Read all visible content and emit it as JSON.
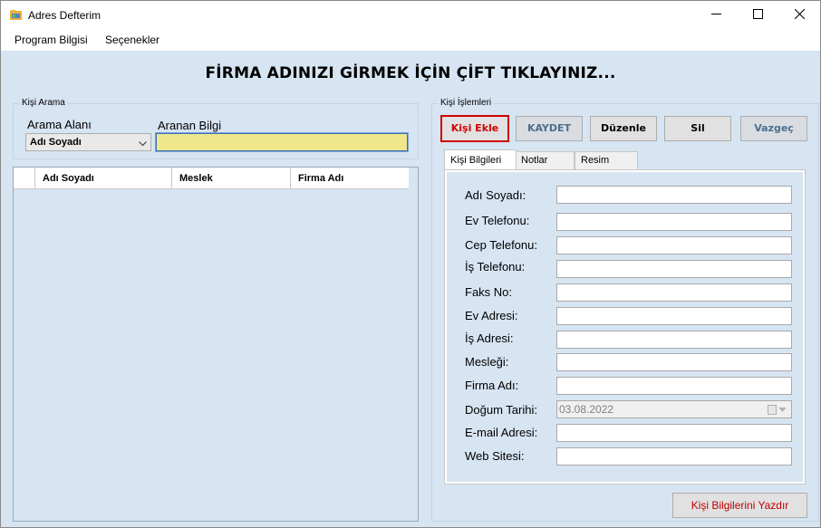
{
  "window": {
    "title": "Adres Defterim",
    "icon": "address-book-icon"
  },
  "menu": {
    "items": [
      "Program Bilgisi",
      "Seçenekler"
    ]
  },
  "banner": "FİRMA ADINIZI GİRMEK İÇİN ÇİFT TIKLAYINIZ...",
  "search": {
    "group_title": "Kişi Arama",
    "field_label": "Arama Alanı",
    "field_value": "Adı Soyadı",
    "query_label": "Aranan Bilgi",
    "query_value": ""
  },
  "grid": {
    "columns": [
      "Adı Soyadı",
      "Meslek",
      "Firma Adı"
    ],
    "rows": []
  },
  "actions": {
    "group_title": "Kişi İşlemleri",
    "add": "Kişi Ekle",
    "save": "KAYDET",
    "edit": "Düzenle",
    "delete": "Sil",
    "cancel": "Vazgeç"
  },
  "tabs": [
    "Kişi Bilgileri",
    "Notlar",
    "Resim"
  ],
  "form": {
    "fields": [
      {
        "label": "Adı Soyadı:",
        "value": ""
      },
      {
        "label": "Ev Telefonu:",
        "value": ""
      },
      {
        "label": "Cep Telefonu:",
        "value": ""
      },
      {
        "label": "İş Telefonu:",
        "value": ""
      },
      {
        "label": "Faks No:",
        "value": ""
      },
      {
        "label": "Ev Adresi:",
        "value": ""
      },
      {
        "label": "İş Adresi:",
        "value": ""
      },
      {
        "label": "Mesleği:",
        "value": ""
      },
      {
        "label": "Firma Adı:",
        "value": ""
      },
      {
        "label": "Doğum Tarihi:",
        "value": "03.08.2022"
      },
      {
        "label": "E-mail Adresi:",
        "value": ""
      },
      {
        "label": "Web Sitesi:",
        "value": ""
      }
    ]
  },
  "print_button": "Kişi Bilgilerini Yazdır",
  "colors": {
    "background": "#d7e4f2",
    "search_highlight": "#f0e68c",
    "accent_red": "#d00000",
    "disabled_text": "#4b6f8e"
  }
}
